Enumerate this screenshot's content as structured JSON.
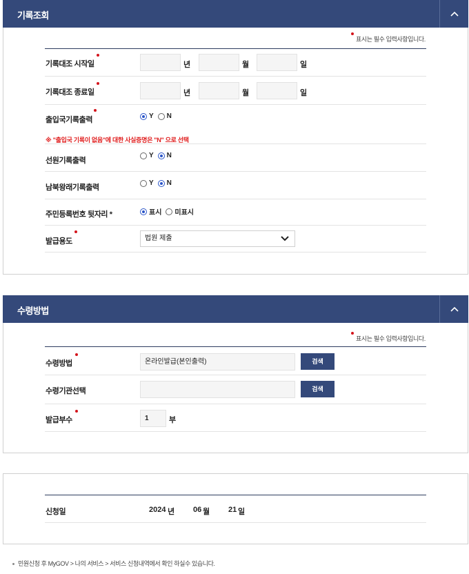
{
  "section1": {
    "title": "기록조회",
    "required_note": "표시는 필수 입력사항입니다.",
    "start_date": {
      "label": "기록대조 시작일",
      "year_unit": "년",
      "month_unit": "월",
      "day_unit": "일"
    },
    "end_date": {
      "label": "기록대조 종료일",
      "year_unit": "년",
      "month_unit": "월",
      "day_unit": "일"
    },
    "immigration_print": {
      "label": "출입국기록출력",
      "yes": "Y",
      "no": "N",
      "selected": "Y"
    },
    "warning": "※ \"출입국 기록이 없음\"에 대한 사실증명은 \"N\" 으로 선택",
    "crew_print": {
      "label": "선원기록출력",
      "yes": "Y",
      "no": "N",
      "selected": "N"
    },
    "inter_korea_print": {
      "label": "남북왕래기록출력",
      "yes": "Y",
      "no": "N",
      "selected": "N"
    },
    "rrn_back": {
      "label": "주민등록번호 뒷자리 *",
      "show": "표시",
      "hide": "미표시",
      "selected": "표시"
    },
    "purpose": {
      "label": "발급용도",
      "value": "법원 제출"
    }
  },
  "section2": {
    "title": "수령방법",
    "required_note": "표시는 필수 입력사항입니다.",
    "method": {
      "label": "수령방법",
      "value": "온라인발급(본인출력)",
      "button": "검색"
    },
    "agency": {
      "label": "수령기관선택",
      "value": "",
      "button": "검색"
    },
    "copies": {
      "label": "발급부수",
      "value": "1",
      "unit": "부"
    }
  },
  "section3": {
    "date_label": "신청일",
    "year": "2024",
    "year_unit": "년",
    "month": "06",
    "month_unit": "월",
    "day": "21",
    "day_unit": "일"
  },
  "footnote": "민원신청 후 MyGOV > 나의 서비스 > 서비스 신청내역에서 확인 하실수 있습니다.",
  "colors": {
    "header_bg": "#34497a",
    "required_dot": "#d4141c",
    "warning": "#e01d1d",
    "radio_on": "#2b55c8"
  }
}
